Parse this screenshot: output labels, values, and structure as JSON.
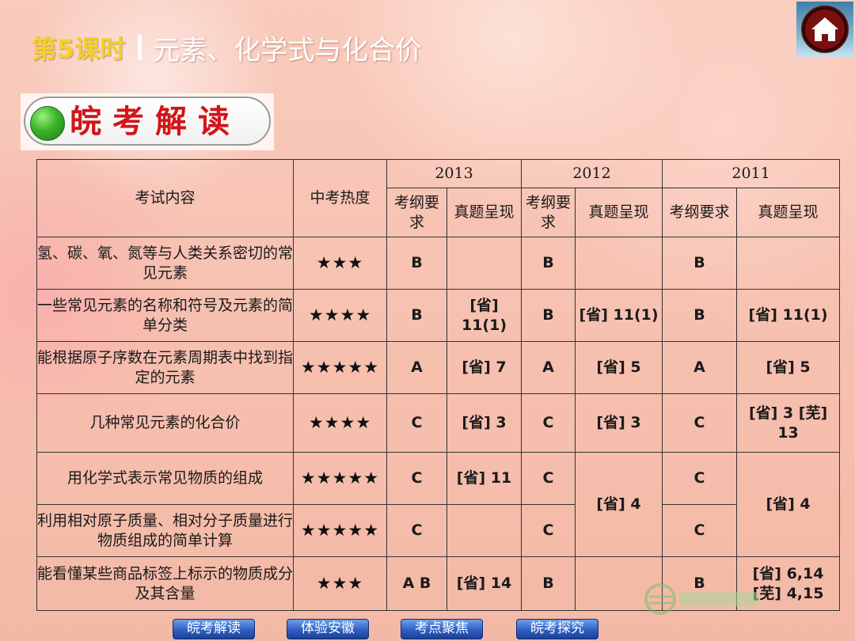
{
  "header": {
    "lesson": "第5课时",
    "title": "元素、化学式与化合价"
  },
  "section": {
    "title": "皖考解读"
  },
  "table": {
    "col_content": "考试内容",
    "col_heat": "中考热度",
    "years": [
      "2013",
      "2012",
      "2011"
    ],
    "sub_req": "考纲要求",
    "sub_real_2013": "真题呈现",
    "sub_real": "真题呈现",
    "rows": [
      {
        "content": "氢、碳、氧、氮等与人类关系密切的常见元素",
        "stars": "★★★",
        "r2013": "B",
        "e2013": "",
        "r2012": "B",
        "e2012": "",
        "r2011": "B",
        "e2011": ""
      },
      {
        "content": "一些常见元素的名称和符号及元素的简单分类",
        "stars": "★★★★",
        "r2013": "B",
        "e2013": "[省] 11(1)",
        "r2012": "B",
        "e2012": "[省] 11(1)",
        "r2011": "B",
        "e2011": "[省] 11(1)"
      },
      {
        "content": "能根据原子序数在元素周期表中找到指定的元素",
        "stars": "★★★★★",
        "r2013": "A",
        "e2013": "[省] 7",
        "r2012": "A",
        "e2012": "[省] 5",
        "r2011": "A",
        "e2011": "[省] 5"
      },
      {
        "content": "几种常见元素的化合价",
        "stars": "★★★★",
        "r2013": "C",
        "e2013": "[省] 3",
        "r2012": "C",
        "e2012": "[省] 3",
        "r2011": "C",
        "e2011": "[省] 3 [芜] 13"
      },
      {
        "content": "用化学式表示常见物质的组成",
        "stars": "★★★★★",
        "r2013": "C",
        "e2013": "[省] 11",
        "r2012": "C",
        "e2012": "[省] 4",
        "r2011": "C",
        "e2011": "[省] 4"
      },
      {
        "content": "利用相对原子质量、相对分子质量进行物质组成的简单计算",
        "stars": "★★★★★",
        "r2013": "C",
        "e2013": "",
        "r2012": "C",
        "r2011": "C"
      },
      {
        "content": "能看懂某些商品标签上标示的物质成分及其含量",
        "stars": "★★★",
        "r2013": "A B",
        "e2013": "[省] 14",
        "r2012": "B",
        "e2012": "",
        "r2011": "B",
        "e2011": "[省] 6,14 [芜] 4,15"
      }
    ]
  },
  "nav": [
    "皖考解读",
    "体验安徽",
    "考点聚焦",
    "皖考探究"
  ],
  "colors": {
    "lesson": "#f2d22a",
    "section_title": "#d4141a",
    "nav_bg": "#2f5fc4"
  }
}
